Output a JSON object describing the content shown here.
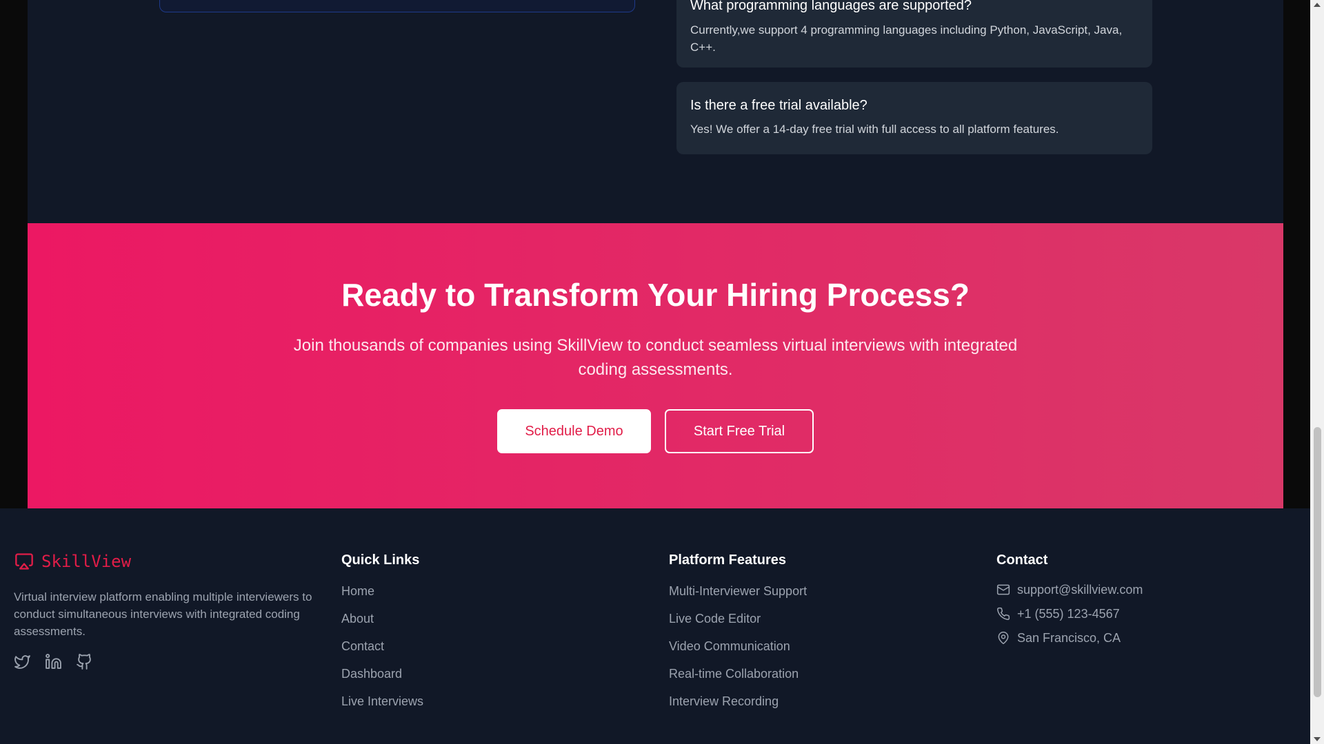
{
  "faq": [
    {
      "question": "What programming languages are supported?",
      "answer": "Currently,we support 4 programming languages including Python, JavaScript, Java, C++."
    },
    {
      "question": "Is there a free trial available?",
      "answer": "Yes! We offer a 14-day free trial with full access to all platform features."
    }
  ],
  "cta": {
    "title": "Ready to Transform Your Hiring Process?",
    "subtitle": "Join thousands of companies using SkillView to conduct seamless virtual interviews with integrated coding assessments.",
    "primary_button": "Schedule Demo",
    "secondary_button": "Start Free Trial"
  },
  "footer": {
    "brand": {
      "name": "SkillView",
      "icon": "monitor-icon",
      "description": "Virtual interview platform enabling multiple interviewers to conduct simultaneous interviews with integrated coding assessments."
    },
    "socials": [
      "twitter-icon",
      "linkedin-icon",
      "github-icon"
    ],
    "quick_links": {
      "title": "Quick Links",
      "items": [
        "Home",
        "About",
        "Contact",
        "Dashboard",
        "Live Interviews"
      ]
    },
    "platform_features": {
      "title": "Platform Features",
      "items": [
        "Multi-Interviewer Support",
        "Live Code Editor",
        "Video Communication",
        "Real-time Collaboration",
        "Interview Recording"
      ]
    },
    "contact": {
      "title": "Contact",
      "email": "support@skillview.com",
      "phone": "+1 (555) 123-4567",
      "location": "San Francisco, CA"
    }
  },
  "colors": {
    "accent": "#e11d48",
    "background": "#111827",
    "card": "#1f2937"
  }
}
